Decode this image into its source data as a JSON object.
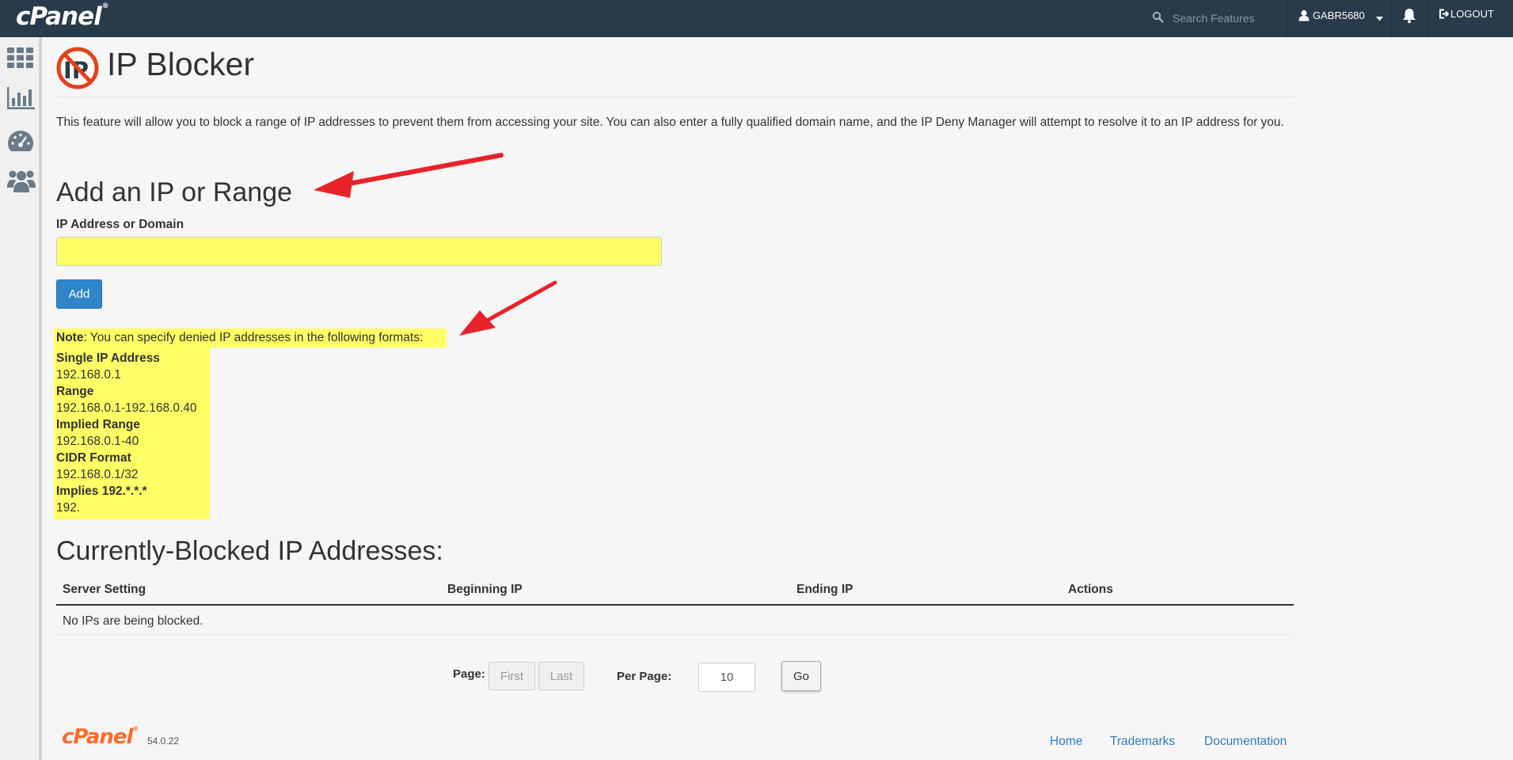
{
  "header": {
    "brand": "cPanel",
    "search_placeholder": "Search Features",
    "username": "GABR5680",
    "logout_label": "LOGOUT"
  },
  "sidebar": {
    "items": [
      {
        "icon": "grid-icon"
      },
      {
        "icon": "bar-chart-icon"
      },
      {
        "icon": "dashboard-gauge-icon"
      },
      {
        "icon": "users-icon"
      }
    ]
  },
  "page": {
    "title": "IP Blocker",
    "description": "This feature will allow you to block a range of IP addresses to prevent them from accessing your site. You can also enter a fully qualified domain name, and the IP Deny Manager will attempt to resolve it to an IP address for you."
  },
  "add_form": {
    "heading": "Add an IP or Range",
    "field_label": "IP Address or Domain",
    "field_value": "",
    "add_label": "Add",
    "highlight_color": "#ffff66"
  },
  "note": {
    "label": "Note",
    "text": ": You can specify denied IP addresses in the following formats:",
    "formats": [
      {
        "name": "Single IP Address",
        "value": "192.168.0.1"
      },
      {
        "name": "Range",
        "value": "192.168.0.1-192.168.0.40"
      },
      {
        "name": "Implied Range",
        "value": "192.168.0.1-40"
      },
      {
        "name": "CIDR Format",
        "value": "192.168.0.1/32"
      },
      {
        "name": "Implies 192.*.*.*",
        "value": "192."
      }
    ]
  },
  "blocked": {
    "heading": "Currently-Blocked IP Addresses:",
    "columns": [
      "Server Setting",
      "Beginning IP",
      "Ending IP",
      "Actions"
    ],
    "empty_message": "No IPs are being blocked."
  },
  "pagination": {
    "page_label": "Page:",
    "first_label": "First",
    "last_label": "Last",
    "per_page_label": "Per Page:",
    "per_page_value": "10",
    "go_label": "Go"
  },
  "footer": {
    "brand": "cPanel",
    "version": "54.0.22",
    "links": [
      "Home",
      "Trademarks",
      "Documentation"
    ]
  },
  "colors": {
    "topbar": "#293a4a",
    "primary_button": "#2f85c9",
    "annotation_arrow": "#e8232a",
    "brand_orange": "#ff6c2c"
  }
}
